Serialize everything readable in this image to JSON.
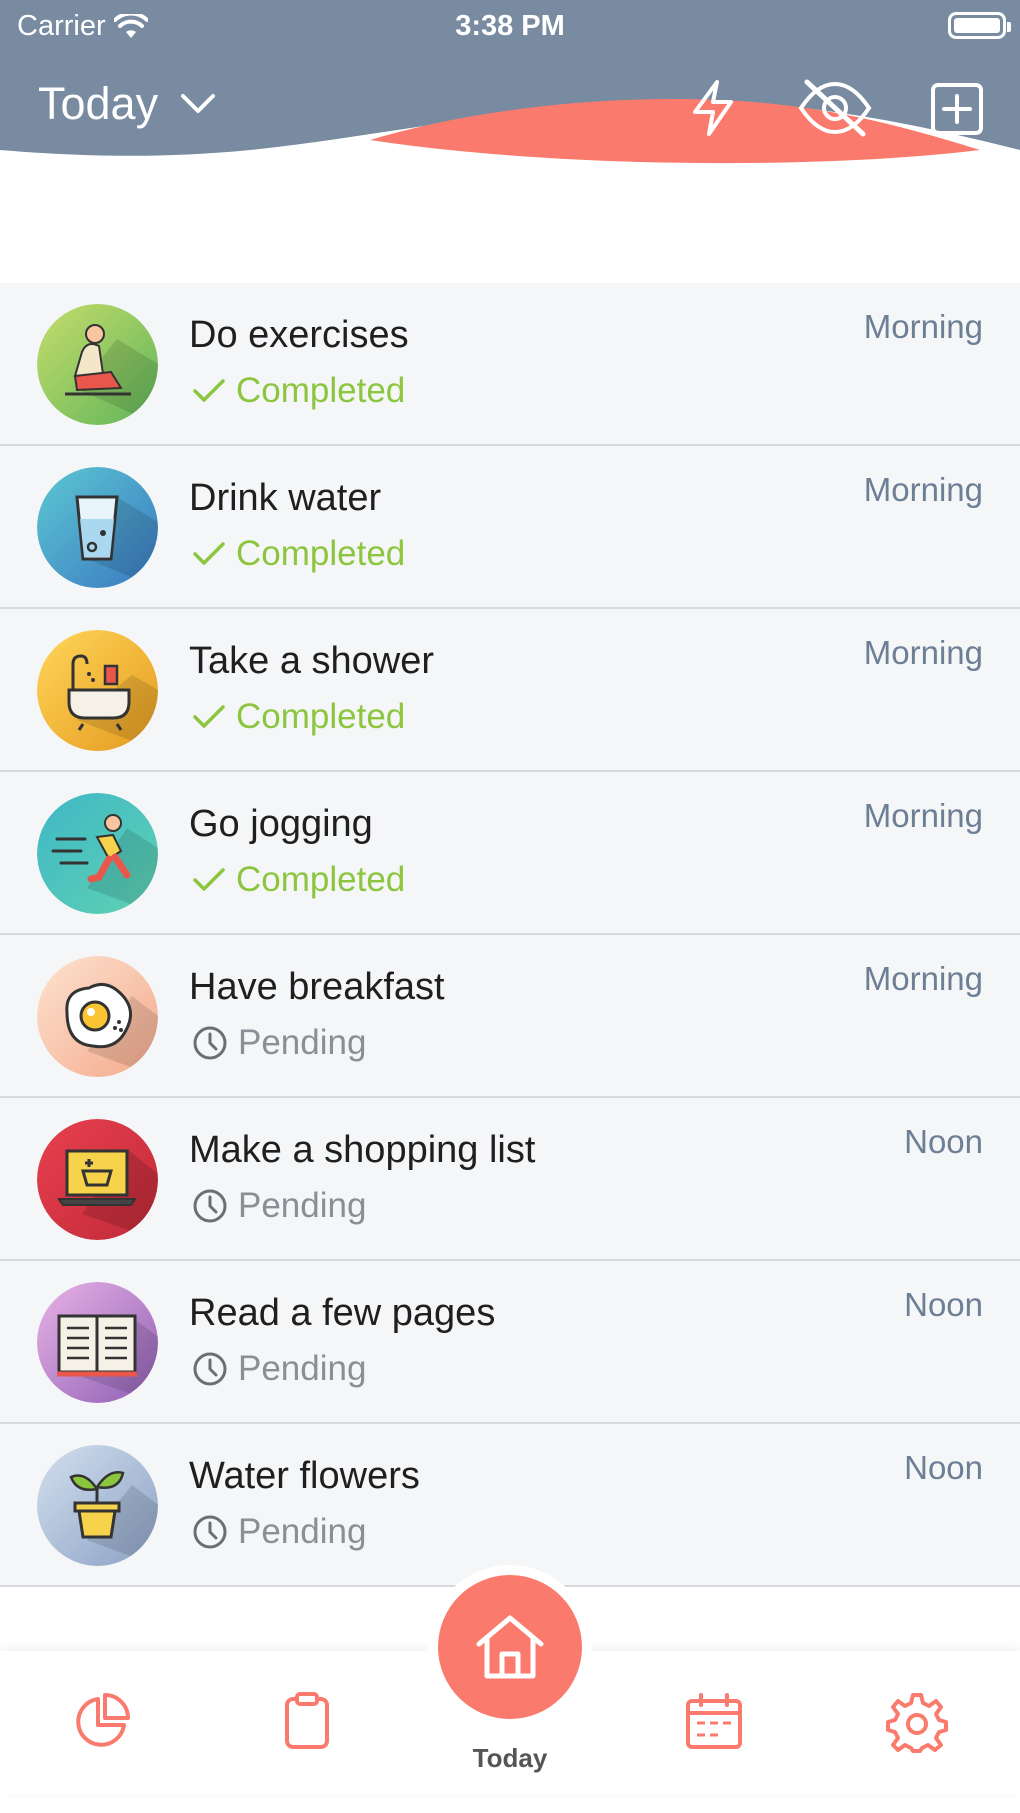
{
  "status_bar": {
    "carrier": "Carrier",
    "time": "3:38 PM"
  },
  "header": {
    "title": "Today"
  },
  "colors": {
    "header_bg": "#788ba0",
    "accent": "#fa7b6d",
    "completed": "#8cc63f",
    "pending": "#8a8f96",
    "time_label": "#6c7f95"
  },
  "habits": [
    {
      "title": "Do exercises",
      "status": "Completed",
      "time": "Morning",
      "icon": "exercise-icon"
    },
    {
      "title": "Drink water",
      "status": "Completed",
      "time": "Morning",
      "icon": "water-glass-icon"
    },
    {
      "title": "Take a shower",
      "status": "Completed",
      "time": "Morning",
      "icon": "bathtub-icon"
    },
    {
      "title": "Go jogging",
      "status": "Completed",
      "time": "Morning",
      "icon": "runner-icon"
    },
    {
      "title": "Have breakfast",
      "status": "Pending",
      "time": "Morning",
      "icon": "fried-egg-icon"
    },
    {
      "title": "Make a shopping list",
      "status": "Pending",
      "time": "Noon",
      "icon": "shopping-laptop-icon"
    },
    {
      "title": "Read a few pages",
      "status": "Pending",
      "time": "Noon",
      "icon": "book-icon"
    },
    {
      "title": "Water flowers",
      "status": "Pending",
      "time": "Noon",
      "icon": "plant-pot-icon"
    }
  ],
  "tabbar": {
    "active_label": "Today"
  }
}
